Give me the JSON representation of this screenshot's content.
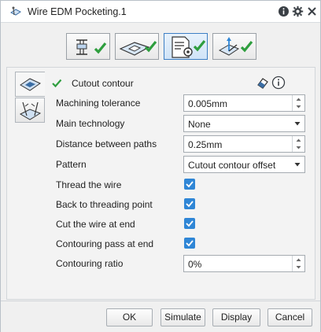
{
  "window": {
    "title": "Wire EDM Pocketing.1",
    "colors": {
      "accent": "#2f86d6",
      "check_green": "#2e9e3e"
    }
  },
  "tabs": [
    {
      "icon": "tool-assembly-icon",
      "done": true,
      "active": false
    },
    {
      "icon": "geometry-part-icon",
      "done": true,
      "active": false
    },
    {
      "icon": "strategy-parameters-icon",
      "done": true,
      "active": true
    },
    {
      "icon": "macro-axis-icon",
      "done": true,
      "active": false
    }
  ],
  "section": {
    "title": "Cutout contour"
  },
  "fields": {
    "machining_tolerance": {
      "label": "Machining tolerance",
      "value": "0.005mm"
    },
    "main_technology": {
      "label": "Main technology",
      "value": "None"
    },
    "distance_between_paths": {
      "label": "Distance between paths",
      "value": "0.25mm"
    },
    "pattern": {
      "label": "Pattern",
      "value": "Cutout contour offset"
    },
    "thread_the_wire": {
      "label": "Thread the wire",
      "checked": true
    },
    "back_to_threading_point": {
      "label": "Back to threading point",
      "checked": true
    },
    "cut_wire_at_end": {
      "label": "Cut the wire at end",
      "checked": true
    },
    "contouring_pass_at_end": {
      "label": "Contouring pass at end",
      "checked": true
    },
    "contouring_ratio": {
      "label": "Contouring ratio",
      "value": "0%"
    }
  },
  "buttons": {
    "ok": "OK",
    "simulate": "Simulate",
    "display": "Display",
    "cancel": "Cancel"
  }
}
